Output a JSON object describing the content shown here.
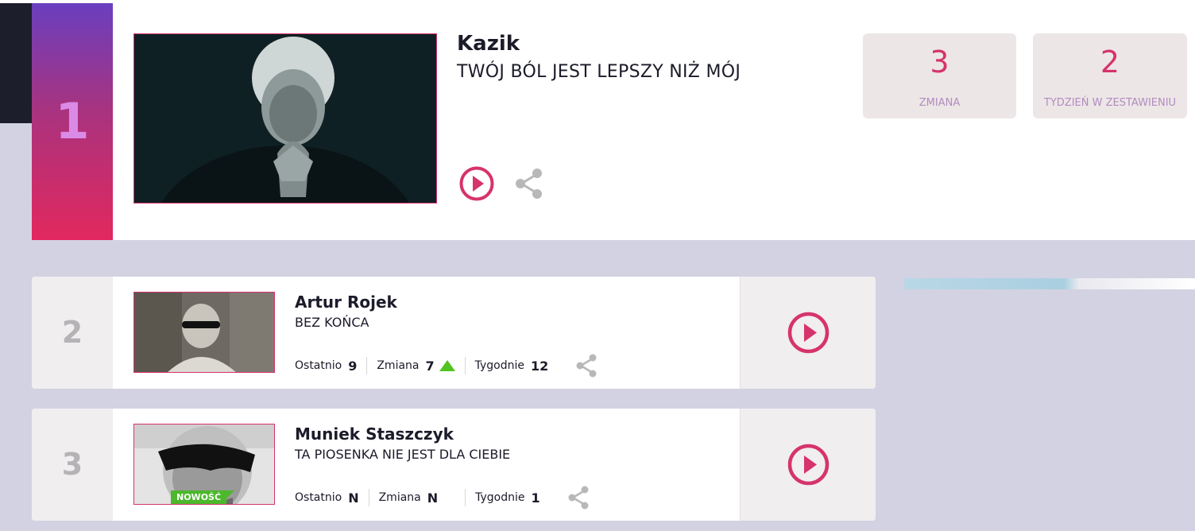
{
  "featured": {
    "rank": "1",
    "artist": "Kazik",
    "title": "TWÓJ BÓL JEST LEPSZY NIŻ MÓJ",
    "change_value": "3",
    "change_label": "ZMIANA",
    "weeks_value": "2",
    "weeks_label": "TYDZIEŃ W ZESTAWIENIU",
    "play_icon": "play-circle-icon",
    "share_icon": "share-icon"
  },
  "rows": [
    {
      "rank": "2",
      "artist": "Artur Rojek",
      "title": "BEZ KOŃCA",
      "last_label": "Ostatnio",
      "last_value": "9",
      "change_label": "Zmiana",
      "change_value": "7",
      "change_direction": "up",
      "weeks_label": "Tygodnie",
      "weeks_value": "12"
    },
    {
      "rank": "3",
      "artist": "Muniek Staszczyk",
      "title": "TA PIOSENKA NIE JEST DLA CIEBIE",
      "badge": "NOWOŚĆ",
      "last_label": "Ostatnio",
      "last_value": "N",
      "change_label": "Zmiana",
      "change_value": "N",
      "weeks_label": "Tygodnie",
      "weeks_value": "1"
    }
  ],
  "colors": {
    "accent": "#d6336c",
    "background": "#d3d2e2",
    "up_arrow": "#52c21e",
    "badge": "#4cb82c"
  }
}
